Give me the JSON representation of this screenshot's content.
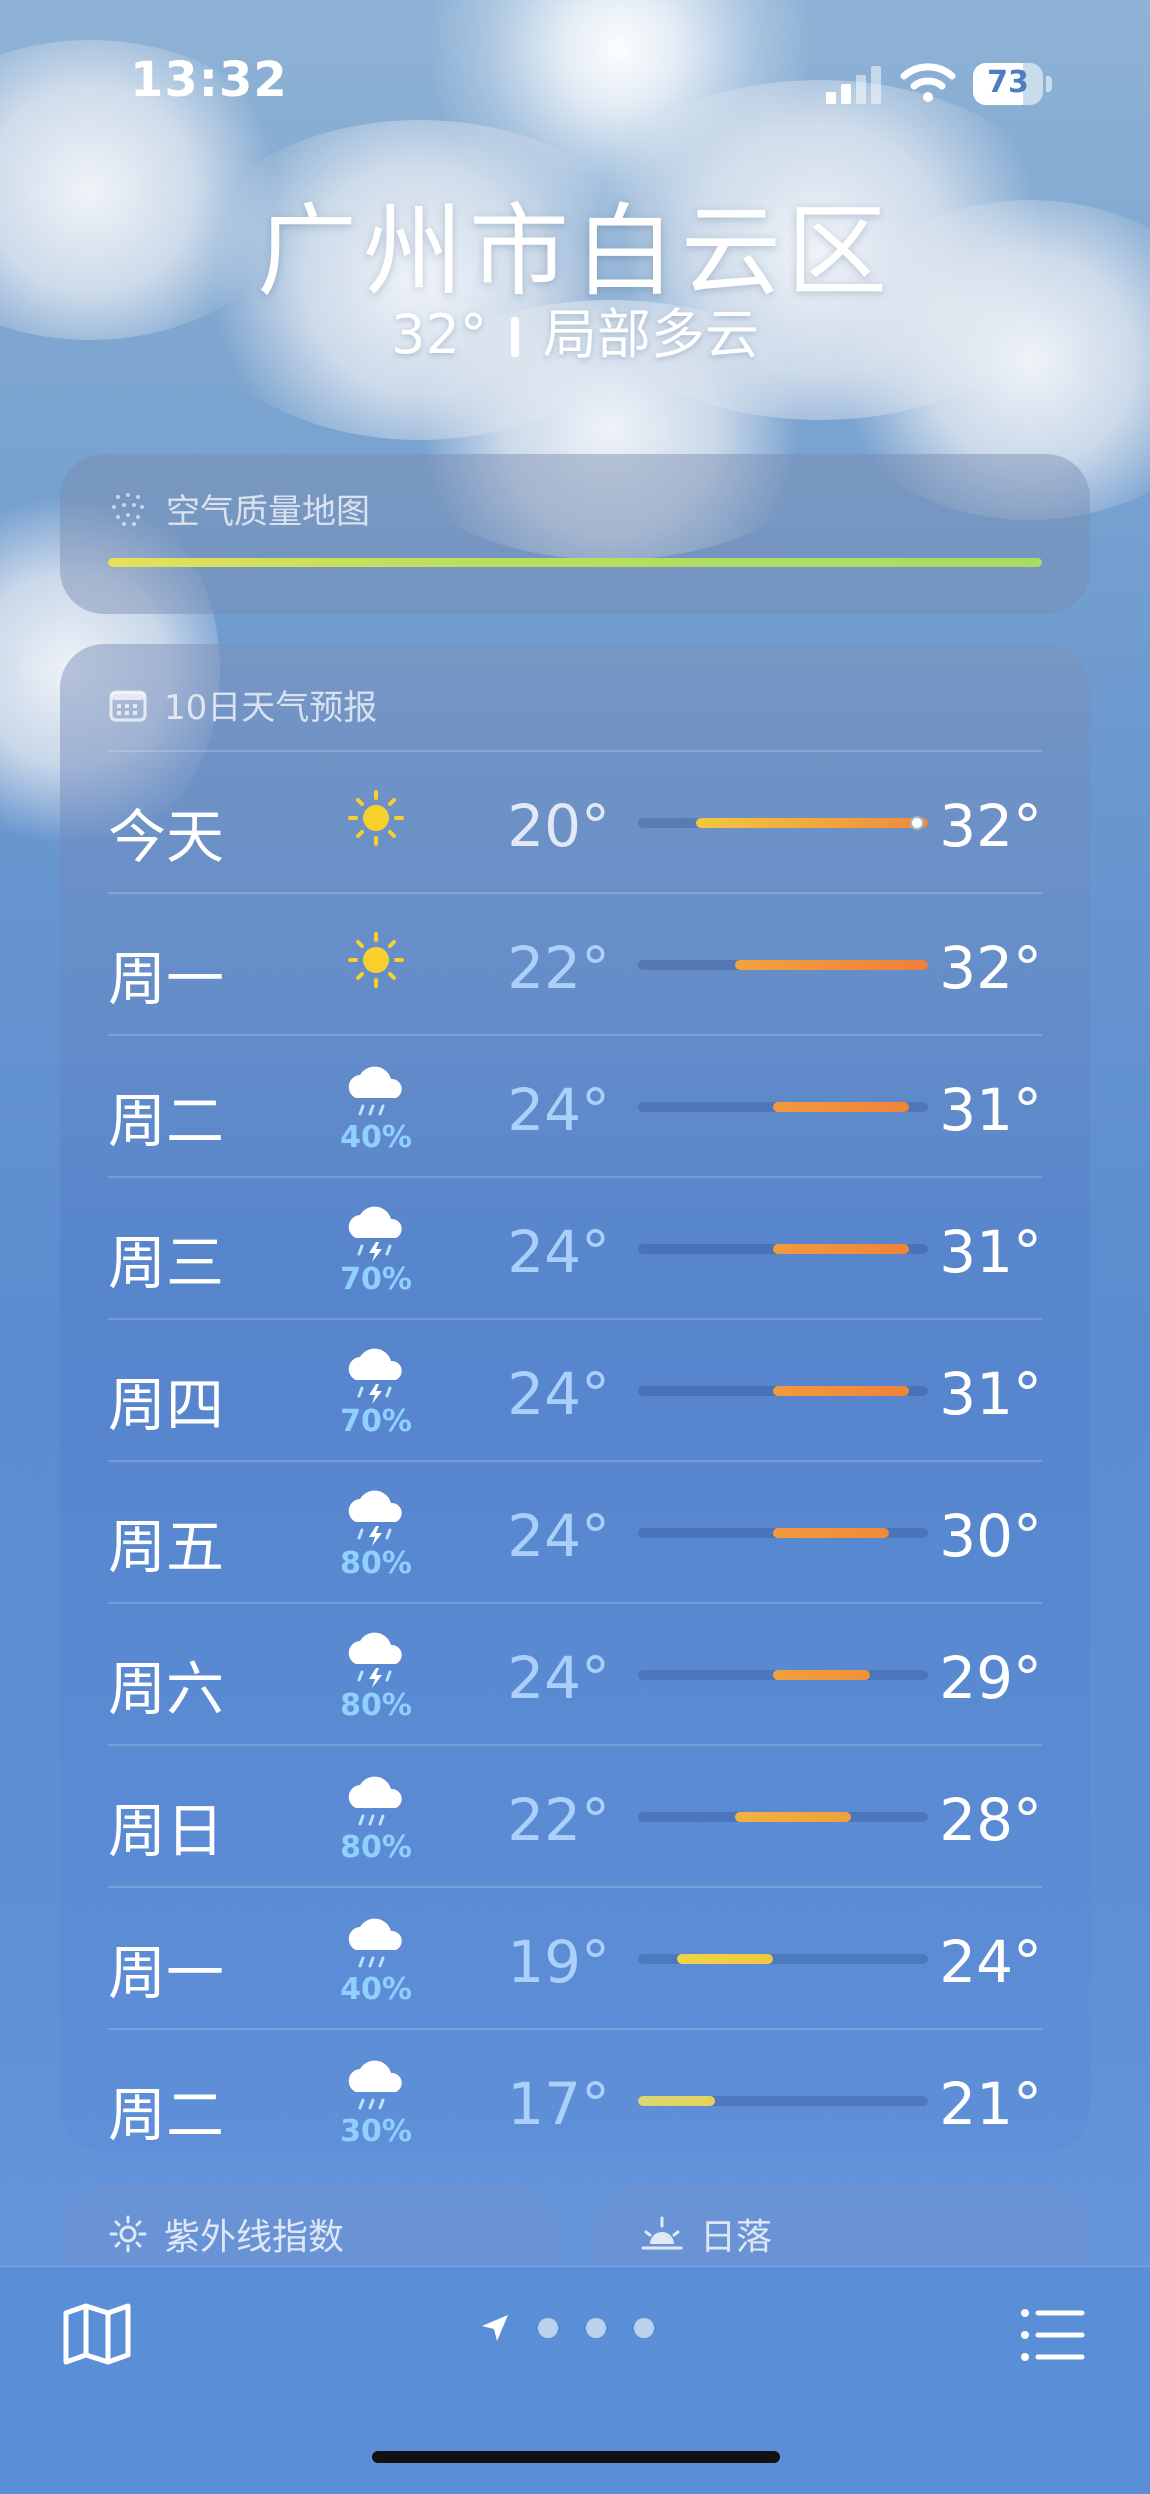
{
  "status_bar": {
    "time": "13:32",
    "battery": "73"
  },
  "header": {
    "location": "广州市白云区",
    "temperature": "32°",
    "condition": "局部多云"
  },
  "air_quality": {
    "title": "空气质量地图"
  },
  "forecast": {
    "title": "10日天气预报",
    "scale": {
      "min": 17,
      "max": 32
    },
    "current_temp": 32,
    "days": [
      {
        "day": "今天",
        "icon": "sun-icon",
        "precip": "",
        "low": "20°",
        "high": "32°",
        "low_val": 20,
        "high_val": 32,
        "color_from": "#f2c73f",
        "color_to": "#f08a3a"
      },
      {
        "day": "周一",
        "icon": "sun-icon",
        "precip": "",
        "low": "22°",
        "high": "32°",
        "low_val": 22,
        "high_val": 32,
        "color_from": "#f2a33e",
        "color_to": "#f07e3a"
      },
      {
        "day": "周二",
        "icon": "cloud-rain-icon",
        "precip": "40%",
        "low": "24°",
        "high": "31°",
        "low_val": 24,
        "high_val": 31,
        "color_from": "#f29a3e",
        "color_to": "#f0833a"
      },
      {
        "day": "周三",
        "icon": "thunderstorm-icon",
        "precip": "70%",
        "low": "24°",
        "high": "31°",
        "low_val": 24,
        "high_val": 31,
        "color_from": "#f29a3e",
        "color_to": "#f0833a"
      },
      {
        "day": "周四",
        "icon": "thunderstorm-icon",
        "precip": "70%",
        "low": "24°",
        "high": "31°",
        "low_val": 24,
        "high_val": 31,
        "color_from": "#f29a3e",
        "color_to": "#f0833a"
      },
      {
        "day": "周五",
        "icon": "thunderstorm-icon",
        "precip": "80%",
        "low": "24°",
        "high": "30°",
        "low_val": 24,
        "high_val": 30,
        "color_from": "#f29a3e",
        "color_to": "#f08a3a"
      },
      {
        "day": "周六",
        "icon": "thunderstorm-icon",
        "precip": "80%",
        "low": "24°",
        "high": "29°",
        "low_val": 24,
        "high_val": 29,
        "color_from": "#f2a03e",
        "color_to": "#f0913a"
      },
      {
        "day": "周日",
        "icon": "cloud-rain-icon",
        "precip": "80%",
        "low": "22°",
        "high": "28°",
        "low_val": 22,
        "high_val": 28,
        "color_from": "#f2b23e",
        "color_to": "#f0a03a"
      },
      {
        "day": "周一",
        "icon": "cloud-rain-icon",
        "precip": "40%",
        "low": "19°",
        "high": "24°",
        "low_val": 19,
        "high_val": 24,
        "color_from": "#f0d44a",
        "color_to": "#f2c640"
      },
      {
        "day": "周二",
        "icon": "cloud-rain-icon",
        "precip": "30%",
        "low": "17°",
        "high": "21°",
        "low_val": 17,
        "high_val": 21,
        "color_from": "#d8d870",
        "color_to": "#e6d25a"
      }
    ]
  },
  "uv_card": {
    "title": "紫外线指数"
  },
  "sunset_card": {
    "title": "日落"
  },
  "toolbar": {
    "pages": 3,
    "active_page": "location"
  }
}
